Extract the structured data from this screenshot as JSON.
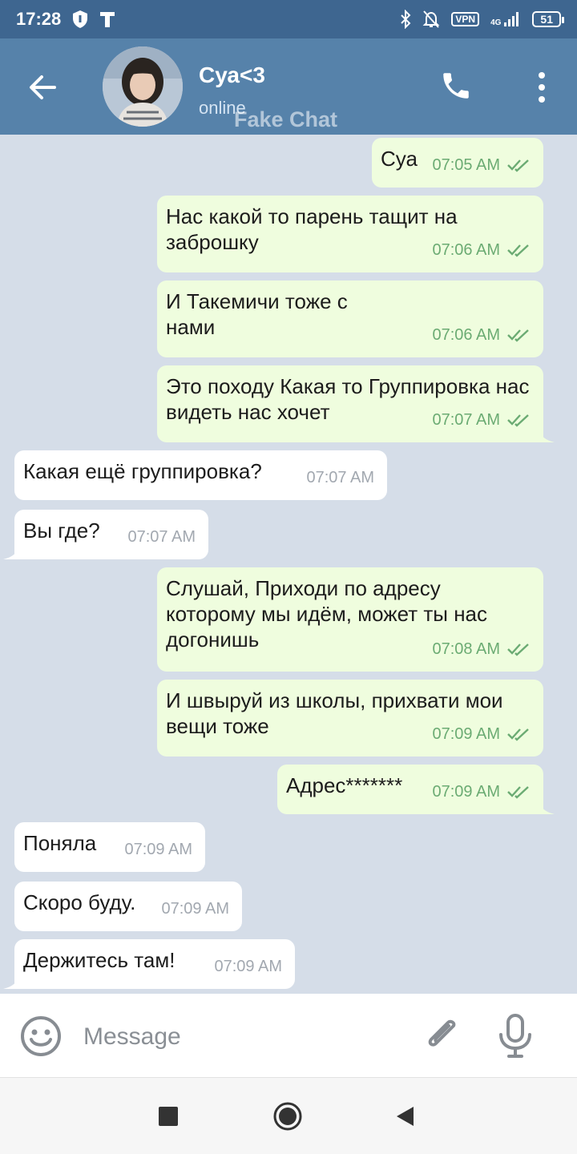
{
  "status_bar": {
    "time": "17:28",
    "vpn": "VPN",
    "network_type": "4G",
    "battery": "51"
  },
  "header": {
    "name": "Суа<3",
    "status": "online",
    "watermark": "Fake Chat"
  },
  "messages": [
    {
      "direction": "out",
      "text": "Суа",
      "time": "07:05 AM"
    },
    {
      "direction": "out",
      "text": "Нас какой то парень тащит на заброшку",
      "time": "07:06 AM"
    },
    {
      "direction": "out",
      "text": "И Такемичи тоже с нами",
      "time": "07:06 AM"
    },
    {
      "direction": "out",
      "text": "Это походу Какая то Группировка нас видеть нас хочет",
      "time": "07:07 AM"
    },
    {
      "direction": "in",
      "text": "Какая ещё группировка?",
      "time": "07:07 AM"
    },
    {
      "direction": "in",
      "text": "Вы где?",
      "time": "07:07 AM"
    },
    {
      "direction": "out",
      "text": "Слушай, Приходи по адресу которому мы идём, может ты нас догонишь",
      "time": "07:08 AM"
    },
    {
      "direction": "out",
      "text": "И швыруй из школы, прихвати мои вещи тоже",
      "time": "07:09 AM"
    },
    {
      "direction": "out",
      "text": "Адрес*******",
      "time": "07:09 AM"
    },
    {
      "direction": "in",
      "text": "Поняла",
      "time": "07:09 AM"
    },
    {
      "direction": "in",
      "text": "Скоро буду.",
      "time": "07:09 AM"
    },
    {
      "direction": "in",
      "text": "Держитесь там!",
      "time": "07:09 AM"
    }
  ],
  "input": {
    "placeholder": "Message"
  },
  "icons": {
    "status": [
      "shield-icon",
      "t-icon",
      "bluetooth-icon",
      "mute-bell-icon",
      "signal-icon"
    ],
    "header": [
      "back-arrow-icon",
      "phone-icon",
      "more-vertical-icon"
    ],
    "input": [
      "emoji-icon",
      "paperclip-icon",
      "microphone-icon"
    ],
    "nav": [
      "recents-icon",
      "home-icon",
      "back-triangle-icon"
    ],
    "read_receipt": "double-check-icon"
  },
  "colors": {
    "status_bar": "#3e6690",
    "header": "#5682aa",
    "chat_background": "#d5dde8",
    "outgoing_bubble": "#effdde",
    "incoming_bubble": "#ffffff",
    "outgoing_time": "#6bab73",
    "incoming_time": "#a2a8b0"
  }
}
